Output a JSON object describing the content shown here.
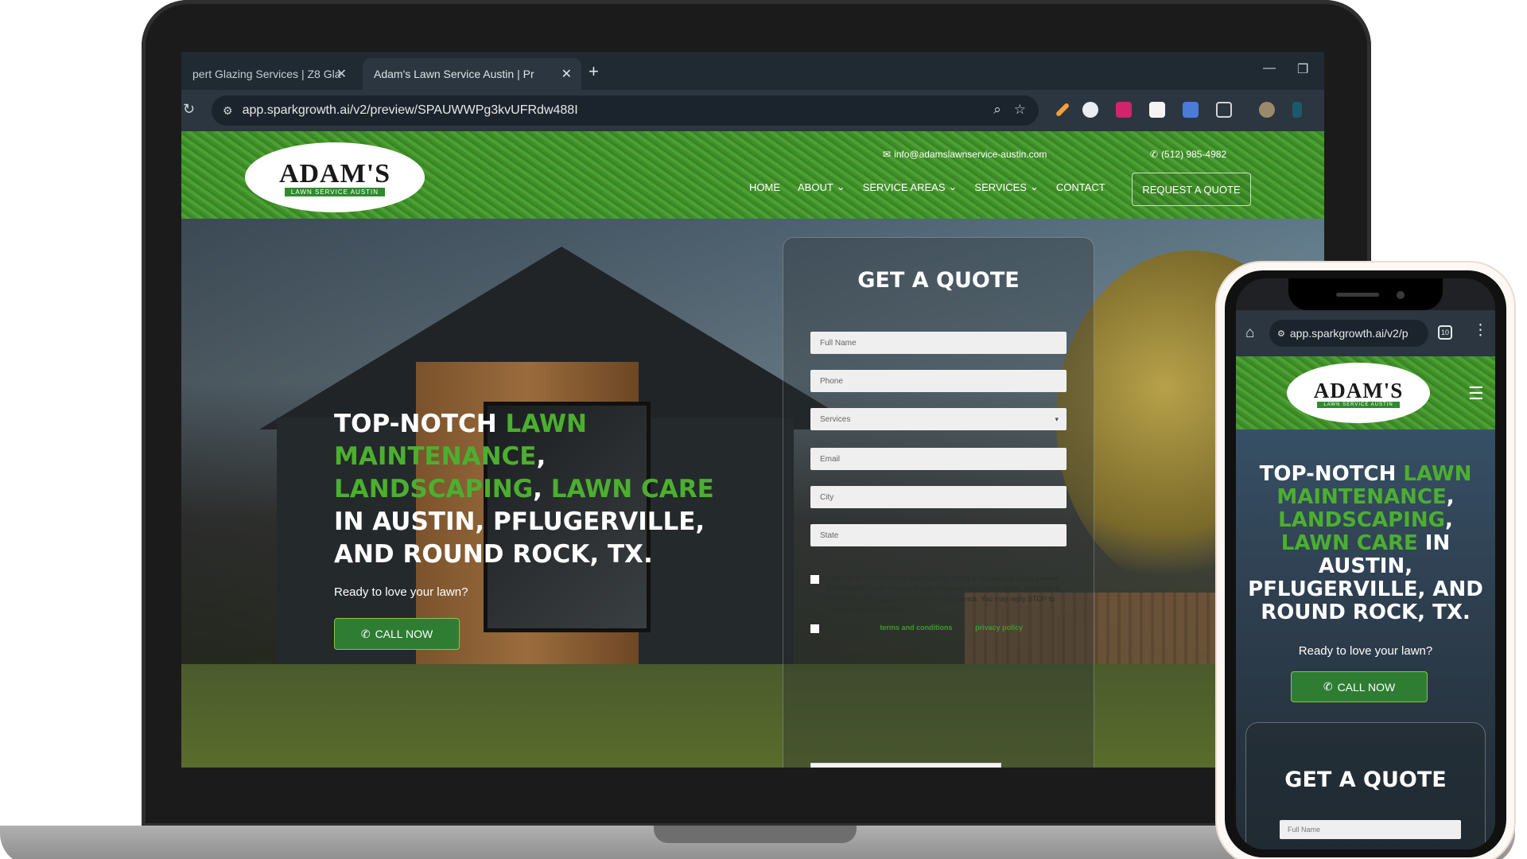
{
  "browser": {
    "tabs": [
      {
        "label": "pert Glazing Services | Z8 Gla",
        "active": false
      },
      {
        "label": "Adam's Lawn Service Austin | Pr",
        "active": true
      }
    ],
    "url": "app.sparkgrowth.ai/v2/preview/SPAUWWPg3kvUFRdw488I"
  },
  "site": {
    "logo": {
      "main": "ADAM'S",
      "sub": "LAWN SERVICE AUSTIN"
    },
    "email": "info@adamslawnservice-austin.com",
    "phone": "(512) 985-4982",
    "nav": [
      {
        "label": "HOME",
        "dropdown": false
      },
      {
        "label": "ABOUT",
        "dropdown": true
      },
      {
        "label": "SERVICE AREAS",
        "dropdown": true
      },
      {
        "label": "SERVICES",
        "dropdown": true
      },
      {
        "label": "CONTACT",
        "dropdown": false
      }
    ],
    "cta": "REQUEST A QUOTE",
    "hero": {
      "headline_parts": {
        "w1": "TOP-NOTCH ",
        "g1": "LAWN MAINTENANCE",
        "s1": ", ",
        "g2": "LANDSCAPING",
        "s2": ", ",
        "g3": "LAWN CARE",
        "rest": " IN AUSTIN, PFLUGERVILLE, AND ROUND ROCK, TX."
      },
      "tagline": "Ready to love your lawn?",
      "call_button": "CALL NOW"
    },
    "quote_form": {
      "title": "GET A QUOTE",
      "fields": {
        "full_name": "Full Name",
        "phone": "Phone",
        "services": "Services",
        "email": "Email",
        "city": "City",
        "state": "State"
      },
      "consent_sms": "Consent to Receive SMS Notifications, Alerts & Occasional Deals Details from Adam's Lawn Service Austin. Message frequency varies. Message & data rates may apply. Text HELP for assistance. You may reply STOP to unsubscribe at any time.",
      "consent_terms_prefix": "I agree to",
      "terms_link": "terms and conditions",
      "privacy_link": "privacy policy"
    }
  },
  "phone": {
    "url": "app.sparkgrowth.ai/v2/p",
    "tab_count": "10",
    "full_name_placeholder": "Full Name"
  }
}
